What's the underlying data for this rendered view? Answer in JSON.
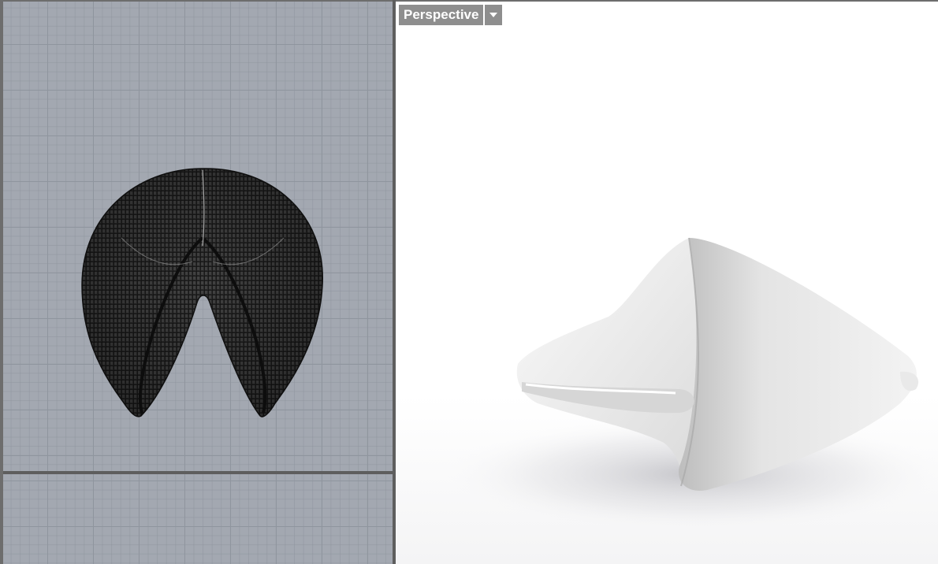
{
  "viewports": {
    "top": {
      "display_mode": "wireframe"
    },
    "bottom": {
      "display_mode": "wireframe"
    },
    "perspective": {
      "label": "Perspective",
      "display_mode": "rendered"
    }
  },
  "icons": {
    "viewport_menu": "chevron-down-icon"
  },
  "colors": {
    "grid_background": "#a3a8b1",
    "grid_lines": "#8f959e",
    "tab_background": "#8e8e8e",
    "divider": "#5e5e5e",
    "render_background": "#ffffff"
  }
}
